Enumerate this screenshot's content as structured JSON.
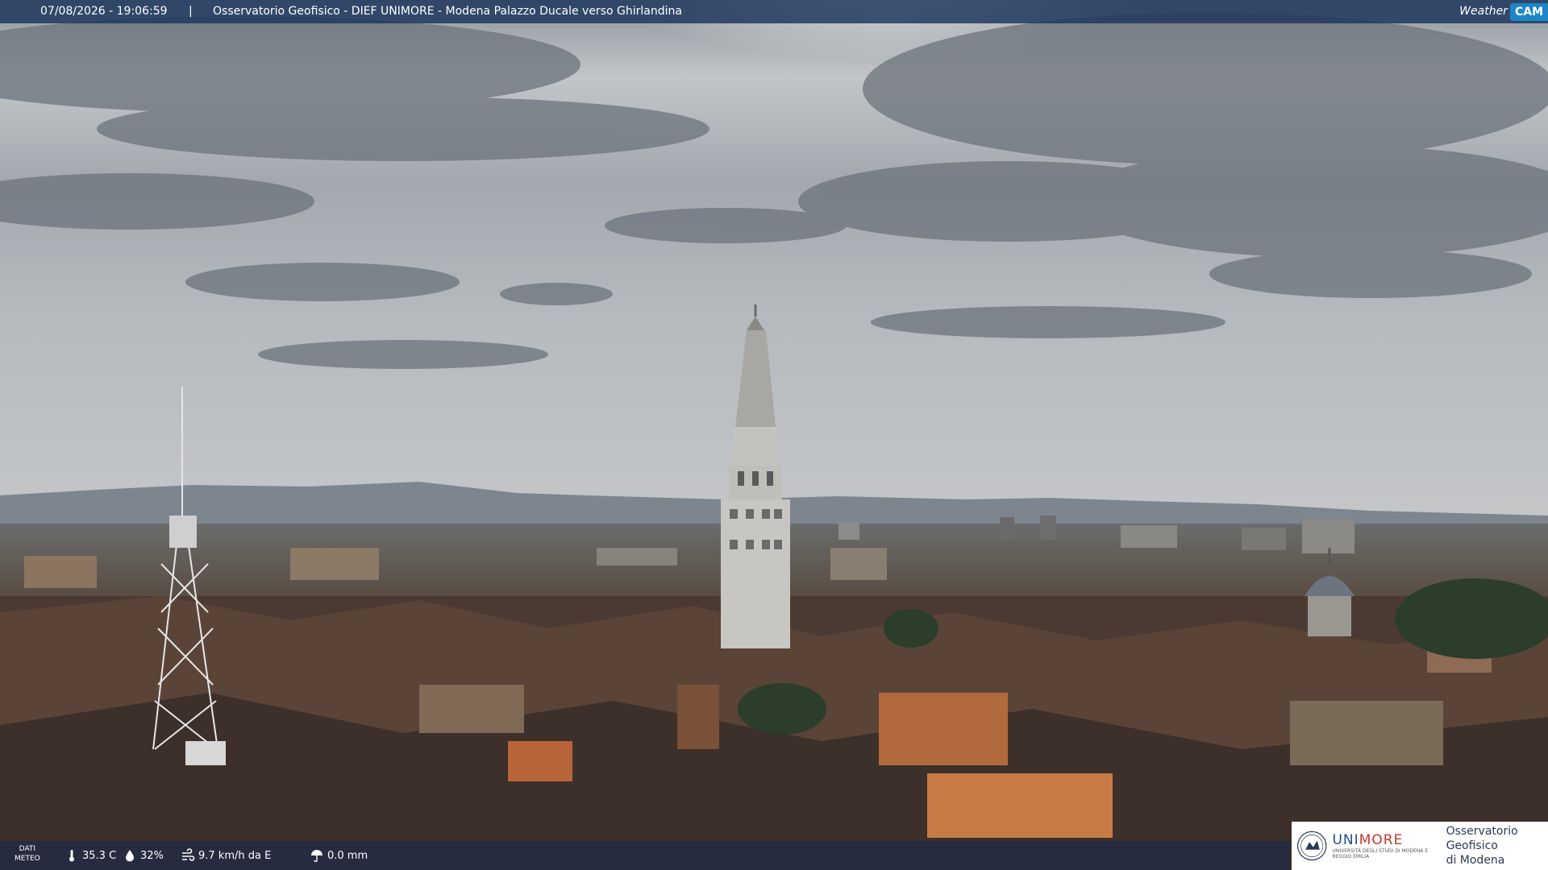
{
  "header": {
    "timestamp": "07/08/2026 - 19:06:59",
    "separator": "|",
    "title": "Osservatorio Geofisico - DIEF UNIMORE - Modena Palazzo Ducale verso Ghirlandina"
  },
  "brand": {
    "weather": "Weather",
    "cam": "CAM"
  },
  "meteo": {
    "label_line1": "DATI",
    "label_line2": "METEO",
    "temperature": "35.3 C",
    "humidity": "32%",
    "wind": "9.7 km/h da E",
    "rain": "0.0 mm"
  },
  "footer_logo": {
    "uni_prefix": "UNI",
    "uni_suffix": "MORE",
    "uni_small": "UNIVERSITÀ DEGLI STUDI DI MODENA E REGGIO EMILIA",
    "observatory_line1": "Osservatorio Geofisico",
    "observatory_line2": "di Modena"
  },
  "colors": {
    "header_bg": "#1c345c",
    "brand_accent": "#1d86c9",
    "uni_red": "#c0392b",
    "uni_blue": "#1a4e8a"
  }
}
